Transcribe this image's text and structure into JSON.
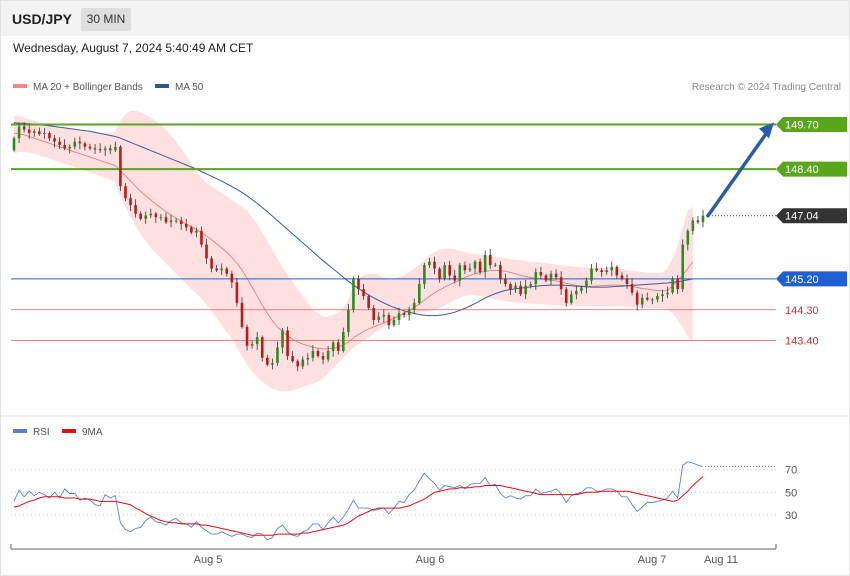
{
  "header": {
    "symbol": "USD/JPY",
    "timeframe": "30 MIN",
    "datetime": "Wednesday, August 7, 2024 5:40:49 AM CET"
  },
  "legend": {
    "ma20": "MA 20 + Bollinger Bands",
    "ma50": "MA 50",
    "credit": "Research © 2024 Trading Central",
    "rsi": "RSI",
    "rsi_ma": "9MA"
  },
  "colors": {
    "resistance": "#5aa51e",
    "pivot": "#1f5fcf",
    "support": "#e36060",
    "current": "#333333",
    "bull_candle": "#2e8b1f",
    "bear_candle": "#b71c1c",
    "ma20": "#e77d7d",
    "ma50": "#3a5a9e",
    "band_fill": "#ffd6d6",
    "arrow": "#2a5ca8",
    "rsi": "#5b7fdc",
    "rsi_ma": "#e01010"
  },
  "chart_data": [
    {
      "type": "candlestick",
      "name": "price",
      "ylim": [
        141.67,
        150.53
      ],
      "levels": [
        {
          "label": "149.70",
          "value": 149.7,
          "kind": "resistance"
        },
        {
          "label": "148.40",
          "value": 148.4,
          "kind": "resistance"
        },
        {
          "label": "147.04",
          "value": 147.04,
          "kind": "current"
        },
        {
          "label": "145.20",
          "value": 145.2,
          "kind": "pivot"
        },
        {
          "label": "144.30",
          "value": 144.3,
          "kind": "support"
        },
        {
          "label": "143.40",
          "value": 143.4,
          "kind": "support"
        }
      ],
      "close": [
        149.3,
        149.64,
        149.55,
        149.45,
        149.5,
        149.42,
        149.45,
        149.3,
        149.2,
        149.1,
        149.0,
        149.05,
        149.2,
        149.15,
        149.05,
        149.0,
        148.98,
        148.95,
        149.0,
        148.95,
        149.05,
        147.9,
        147.55,
        147.35,
        147.1,
        146.95,
        147.05,
        147.1,
        147.0,
        147.0,
        146.85,
        146.9,
        146.9,
        146.8,
        146.7,
        146.55,
        146.6,
        146.2,
        145.8,
        145.5,
        145.45,
        145.5,
        145.35,
        145.1,
        144.5,
        143.8,
        143.25,
        143.3,
        143.5,
        142.9,
        142.7,
        142.75,
        143.2,
        143.7,
        142.95,
        142.8,
        142.65,
        142.85,
        142.9,
        143.1,
        142.95,
        142.85,
        143.1,
        143.35,
        143.1,
        143.65,
        144.3,
        145.2,
        144.9,
        144.7,
        144.35,
        144.0,
        144.1,
        144.15,
        143.85,
        144.0,
        144.2,
        144.15,
        144.3,
        144.5,
        145.05,
        145.6,
        145.7,
        145.5,
        145.2,
        145.6,
        145.3,
        145.15,
        145.6,
        145.45,
        145.5,
        145.7,
        145.4,
        145.9,
        145.6,
        145.6,
        145.2,
        145.05,
        144.9,
        145.0,
        144.75,
        145.0,
        145.05,
        145.4,
        145.3,
        145.15,
        145.35,
        145.25,
        144.9,
        144.5,
        144.75,
        144.85,
        144.95,
        145.15,
        145.5,
        145.45,
        145.4,
        145.45,
        145.55,
        145.3,
        145.2,
        145.05,
        144.8,
        144.45,
        144.65,
        144.6,
        144.6,
        144.7,
        144.75,
        144.8,
        145.2,
        144.9,
        146.2,
        146.6,
        146.9,
        146.85,
        147.04
      ],
      "ma20": [
        149.45,
        149.42,
        149.4,
        149.35,
        149.3,
        149.25,
        149.2,
        149.15,
        149.1,
        149.05,
        149.0,
        148.95,
        148.9,
        148.85,
        148.8,
        148.75,
        148.7,
        148.65,
        148.6,
        148.55,
        148.5,
        148.35,
        148.2,
        148.05,
        147.9,
        147.75,
        147.62,
        147.5,
        147.38,
        147.27,
        147.16,
        147.06,
        146.97,
        146.88,
        146.8,
        146.72,
        146.64,
        146.55,
        146.45,
        146.34,
        146.22,
        146.1,
        145.97,
        145.83,
        145.66,
        145.46,
        145.22,
        144.96,
        144.7,
        144.44,
        144.2,
        143.98,
        143.8,
        143.66,
        143.54,
        143.44,
        143.36,
        143.3,
        143.25,
        143.21,
        143.18,
        143.16,
        143.16,
        143.18,
        143.21,
        143.27,
        143.36,
        143.48,
        143.58,
        143.67,
        143.74,
        143.8,
        143.86,
        143.92,
        143.98,
        144.05,
        144.12,
        144.2,
        144.28,
        144.37,
        144.47,
        144.58,
        144.69,
        144.79,
        144.88,
        144.96,
        145.03,
        145.1,
        145.17,
        145.24,
        145.3,
        145.35,
        145.39,
        145.42,
        145.44,
        145.45,
        145.44,
        145.42,
        145.39,
        145.35,
        145.3,
        145.27,
        145.24,
        145.22,
        145.2,
        145.18,
        145.16,
        145.14,
        145.11,
        145.07,
        145.04,
        145.01,
        144.99,
        144.98,
        144.98,
        144.99,
        145.0,
        145.01,
        145.02,
        145.02,
        145.01,
        145.0,
        144.98,
        144.95,
        144.92,
        144.9,
        144.88,
        144.86,
        144.85,
        144.86,
        145.0,
        145.15,
        145.32,
        145.5,
        145.7
      ],
      "bb_upper": [
        149.95,
        149.95,
        149.9,
        149.85,
        149.8,
        149.75,
        149.72,
        149.68,
        149.65,
        149.62,
        149.6,
        149.58,
        149.55,
        149.52,
        149.5,
        149.48,
        149.46,
        149.45,
        149.45,
        149.45,
        149.5,
        149.8,
        150.0,
        150.1,
        150.1,
        150.05,
        149.98,
        149.9,
        149.8,
        149.7,
        149.55,
        149.38,
        149.2,
        149.0,
        148.8,
        148.55,
        148.3,
        148.15,
        148.0,
        147.9,
        147.8,
        147.7,
        147.6,
        147.5,
        147.4,
        147.3,
        147.2,
        147.0,
        146.8,
        146.55,
        146.3,
        146.05,
        145.8,
        145.55,
        145.3,
        145.1,
        144.9,
        144.7,
        144.5,
        144.3,
        144.2,
        144.1,
        144.1,
        144.15,
        144.2,
        144.35,
        144.6,
        145.0,
        145.2,
        145.3,
        145.35,
        145.35,
        145.3,
        145.25,
        145.2,
        145.2,
        145.25,
        145.3,
        145.4,
        145.5,
        145.62,
        145.75,
        145.88,
        145.98,
        146.05,
        146.08,
        146.08,
        146.06,
        146.02,
        145.98,
        145.95,
        145.92,
        145.9,
        145.88,
        145.86,
        145.84,
        145.82,
        145.8,
        145.78,
        145.76,
        145.74,
        145.72,
        145.7,
        145.69,
        145.68,
        145.66,
        145.64,
        145.62,
        145.6,
        145.58,
        145.56,
        145.55,
        145.54,
        145.53,
        145.53,
        145.53,
        145.53,
        145.53,
        145.52,
        145.5,
        145.48,
        145.46,
        145.44,
        145.42,
        145.4,
        145.38,
        145.37,
        145.37,
        145.38,
        145.5,
        145.8,
        146.2,
        146.7,
        147.2,
        147.3
      ],
      "bb_lower": [
        148.85,
        148.9,
        148.9,
        148.88,
        148.85,
        148.8,
        148.75,
        148.7,
        148.65,
        148.6,
        148.55,
        148.5,
        148.45,
        148.4,
        148.35,
        148.3,
        148.25,
        148.2,
        148.15,
        148.1,
        148.0,
        147.6,
        147.3,
        147.0,
        146.75,
        146.5,
        146.3,
        146.1,
        145.95,
        145.8,
        145.65,
        145.5,
        145.35,
        145.2,
        145.05,
        144.9,
        144.78,
        144.62,
        144.45,
        144.25,
        144.05,
        143.85,
        143.65,
        143.45,
        143.2,
        142.95,
        142.7,
        142.5,
        142.35,
        142.2,
        142.1,
        142.0,
        141.95,
        141.92,
        141.92,
        141.95,
        142.0,
        142.05,
        142.1,
        142.15,
        142.2,
        142.3,
        142.45,
        142.6,
        142.75,
        142.9,
        143.05,
        143.2,
        143.3,
        143.4,
        143.5,
        143.6,
        143.7,
        143.8,
        143.88,
        143.95,
        144.02,
        144.08,
        144.13,
        144.18,
        144.22,
        144.25,
        144.27,
        144.3,
        144.35,
        144.42,
        144.5,
        144.58,
        144.65,
        144.7,
        144.72,
        144.72,
        144.7,
        144.67,
        144.63,
        144.6,
        144.57,
        144.55,
        144.53,
        144.51,
        144.5,
        144.49,
        144.48,
        144.47,
        144.46,
        144.45,
        144.44,
        144.43,
        144.42,
        144.41,
        144.4,
        144.4,
        144.4,
        144.4,
        144.4,
        144.41,
        144.41,
        144.41,
        144.41,
        144.4,
        144.4,
        144.39,
        144.38,
        144.37,
        144.36,
        144.35,
        144.35,
        144.35,
        144.34,
        144.3,
        144.2,
        144.0,
        143.8,
        143.5,
        143.4
      ],
      "ma50": [
        149.75,
        149.74,
        149.73,
        149.72,
        149.71,
        149.7,
        149.68,
        149.66,
        149.64,
        149.62,
        149.6,
        149.58,
        149.56,
        149.54,
        149.52,
        149.5,
        149.47,
        149.44,
        149.41,
        149.38,
        149.35,
        149.3,
        149.24,
        149.18,
        149.12,
        149.06,
        149.0,
        148.94,
        148.88,
        148.82,
        148.76,
        148.7,
        148.64,
        148.58,
        148.52,
        148.46,
        148.4,
        148.33,
        148.26,
        148.19,
        148.12,
        148.05,
        147.97,
        147.89,
        147.81,
        147.72,
        147.62,
        147.51,
        147.4,
        147.28,
        147.16,
        147.03,
        146.9,
        146.77,
        146.64,
        146.51,
        146.38,
        146.25,
        146.12,
        145.99,
        145.86,
        145.73,
        145.61,
        145.49,
        145.37,
        145.25,
        145.13,
        145.02,
        144.92,
        144.82,
        144.73,
        144.65,
        144.57,
        144.5,
        144.43,
        144.37,
        144.32,
        144.27,
        144.23,
        144.19,
        144.16,
        144.14,
        144.13,
        144.13,
        144.14,
        144.16,
        144.19,
        144.23,
        144.28,
        144.34,
        144.41,
        144.48,
        144.56,
        144.64,
        144.71,
        144.77,
        144.82,
        144.86,
        144.89,
        144.91,
        144.93,
        144.95,
        144.97,
        144.99,
        145.0,
        145.01,
        145.02,
        145.02,
        145.02,
        145.01,
        145.0,
        144.99,
        144.98,
        144.97,
        144.96,
        144.96,
        144.96,
        144.96,
        144.97,
        144.98,
        144.99,
        145.0,
        145.01,
        145.02,
        145.03,
        145.04,
        145.05,
        145.06,
        145.07,
        145.08,
        145.1,
        145.12,
        145.14,
        145.17,
        145.2
      ]
    },
    {
      "type": "line",
      "name": "rsi",
      "ylim": [
        6,
        99
      ],
      "yticks": [
        30,
        50,
        70
      ],
      "xticks": [
        "Aug 5",
        "Aug 6",
        "Aug 7",
        "Aug 11"
      ],
      "rsi": [
        42,
        52,
        46,
        51,
        47,
        50,
        48,
        45,
        50,
        45,
        53,
        49,
        49,
        43,
        45,
        43,
        39,
        38,
        48,
        45,
        47,
        23,
        17,
        15,
        18,
        19,
        25,
        28,
        24,
        23,
        21,
        25,
        27,
        23,
        22,
        19,
        24,
        19,
        16,
        13,
        13,
        15,
        13,
        11,
        13,
        13,
        11,
        10,
        14,
        13,
        8,
        10,
        18,
        21,
        15,
        12,
        11,
        15,
        17,
        22,
        22,
        17,
        23,
        28,
        23,
        28,
        35,
        43,
        36,
        36,
        36,
        34,
        35,
        36,
        31,
        36,
        42,
        41,
        48,
        52,
        60,
        67,
        62,
        58,
        52,
        56,
        55,
        54,
        56,
        53,
        57,
        58,
        58,
        63,
        56,
        57,
        49,
        45,
        47,
        45,
        44,
        47,
        47,
        53,
        49,
        50,
        51,
        53,
        49,
        41,
        47,
        49,
        50,
        54,
        54,
        51,
        51,
        53,
        53,
        51,
        46,
        46,
        39,
        33,
        37,
        41,
        41,
        42,
        43,
        45,
        51,
        45,
        74,
        77,
        76,
        74,
        73
      ],
      "rsi_ma": [
        37,
        38,
        40,
        42,
        43,
        45,
        46,
        46,
        46,
        46,
        45,
        45,
        45,
        44,
        44,
        44,
        43,
        42,
        42,
        42,
        42,
        41,
        40,
        39,
        36,
        34,
        31,
        29,
        27,
        25,
        24,
        23,
        23,
        22,
        22,
        22,
        22,
        21,
        21,
        20,
        19,
        18,
        17,
        16,
        15,
        14,
        13,
        12,
        12,
        12,
        12,
        12,
        13,
        13,
        13,
        13,
        13,
        14,
        14,
        15,
        16,
        17,
        18,
        19,
        20,
        21,
        23,
        26,
        29,
        31,
        33,
        35,
        36,
        36,
        36,
        36,
        36,
        37,
        38,
        40,
        42,
        44,
        47,
        50,
        51,
        52,
        53,
        53,
        54,
        54,
        54,
        55,
        55,
        56,
        56,
        56,
        56,
        55,
        54,
        53,
        52,
        51,
        50,
        49,
        48,
        48,
        48,
        48,
        48,
        48,
        48,
        48,
        49,
        50,
        50,
        50,
        51,
        51,
        51,
        51,
        51,
        51,
        50,
        49,
        48,
        47,
        46,
        45,
        44,
        43,
        42,
        43,
        47,
        51,
        56,
        60,
        64
      ]
    }
  ]
}
